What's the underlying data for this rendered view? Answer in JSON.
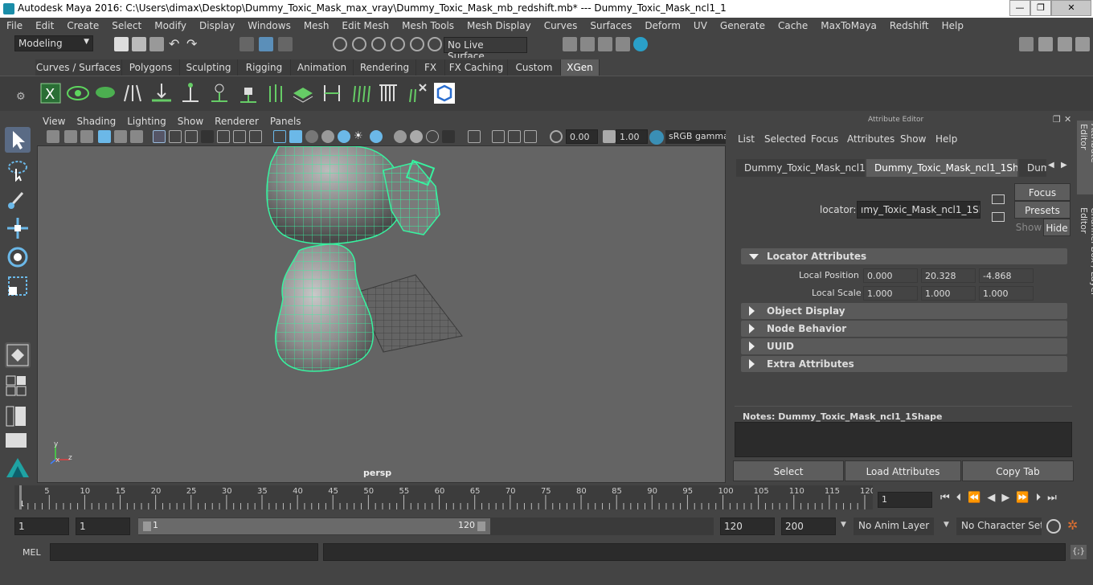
{
  "window": {
    "title": "Autodesk Maya 2016: C:\\Users\\dimax\\Desktop\\Dummy_Toxic_Mask_max_vray\\Dummy_Toxic_Mask_mb_redshift.mb*   ---   Dummy_Toxic_Mask_ncl1_1",
    "min_label": "—",
    "max_label": "❐",
    "close_label": "✕"
  },
  "menu": [
    "File",
    "Edit",
    "Create",
    "Select",
    "Modify",
    "Display",
    "Windows",
    "Mesh",
    "Edit Mesh",
    "Mesh Tools",
    "Mesh Display",
    "Curves",
    "Surfaces",
    "Deform",
    "UV",
    "Generate",
    "Cache",
    "MaxToMaya",
    "Redshift",
    "Help"
  ],
  "status": {
    "mode": "Modeling",
    "live_surface": "No Live Surface"
  },
  "shelf_tabs": [
    "Curves / Surfaces",
    "Polygons",
    "Sculpting",
    "Rigging",
    "Animation",
    "Rendering",
    "FX",
    "FX Caching",
    "Custom",
    "XGen"
  ],
  "shelf_active": "XGen",
  "panel_menu": [
    "View",
    "Shading",
    "Lighting",
    "Show",
    "Renderer",
    "Panels"
  ],
  "panel_tools": {
    "value_a": "0.00",
    "value_b": "1.00",
    "color_space": "sRGB gamma"
  },
  "viewport": {
    "camera_label": "persp",
    "axis_x": "x",
    "axis_y": "y",
    "axis_z": "z"
  },
  "attribute_editor": {
    "header": "Attribute Editor",
    "menu": [
      "List",
      "Selected",
      "Focus",
      "Attributes",
      "Show",
      "Help"
    ],
    "tabs": [
      "Dummy_Toxic_Mask_ncl1_1",
      "Dummy_Toxic_Mask_ncl1_1Shape",
      "Dum"
    ],
    "active_tab": "Dummy_Toxic_Mask_ncl1_1Shape",
    "locator_label": "locator:",
    "locator_value": "ımy_Toxic_Mask_ncl1_1Shape",
    "focus_label": "Focus",
    "presets_label": "Presets",
    "show_label": "Show",
    "hide_label": "Hide",
    "sections": {
      "locator_attributes": "Locator Attributes",
      "object_display": "Object Display",
      "node_behavior": "Node Behavior",
      "uuid": "UUID",
      "extra_attributes": "Extra Attributes"
    },
    "local_position": {
      "label": "Local Position",
      "x": "0.000",
      "y": "20.328",
      "z": "-4.868"
    },
    "local_scale": {
      "label": "Local Scale",
      "x": "1.000",
      "y": "1.000",
      "z": "1.000"
    },
    "notes_label": "Notes:  Dummy_Toxic_Mask_ncl1_1Shape",
    "select_label": "Select",
    "load_label": "Load Attributes",
    "copy_label": "Copy Tab",
    "side_tab_1": "Attribute Editor",
    "side_tab_2": "Channel Box / Layer Editor"
  },
  "time_slider": {
    "ticks": [
      "1",
      "5",
      "10",
      "15",
      "20",
      "25",
      "30",
      "35",
      "40",
      "45",
      "50",
      "55",
      "60",
      "65",
      "70",
      "75",
      "80",
      "85",
      "90",
      "95",
      "100",
      "105",
      "110",
      "115",
      "120"
    ],
    "current": "1"
  },
  "range": {
    "start": "1",
    "start_inner": "1",
    "slider_start": "1",
    "slider_end": "120",
    "end_inner": "120",
    "end": "200",
    "anim_layer": "No Anim Layer",
    "char_set": "No Character Set"
  },
  "cmdline": {
    "label": "MEL"
  },
  "colors": {
    "wire": "#38f2a0",
    "bg": "#444444",
    "viewport": "#646464"
  }
}
